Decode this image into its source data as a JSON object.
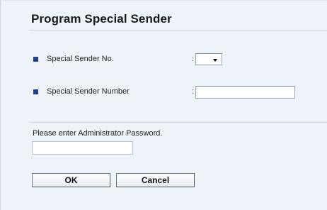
{
  "page": {
    "title": "Program Special Sender"
  },
  "fields": {
    "sender_no": {
      "label": "Special Sender No.",
      "separator": ":",
      "selected_value": ""
    },
    "sender_number": {
      "label": "Special Sender Number",
      "separator": ":",
      "value": ""
    }
  },
  "password": {
    "prompt": "Please enter Administrator Password.",
    "value": ""
  },
  "buttons": {
    "ok_label": "OK",
    "cancel_label": "Cancel"
  },
  "colors": {
    "panel_bg": "#eef3fa",
    "bullet": "#1f3f8c",
    "rule": "#c4d2e3"
  },
  "icons": {
    "bullet": "square-bullet-icon",
    "dropdown": "dropdown-arrow-icon"
  }
}
